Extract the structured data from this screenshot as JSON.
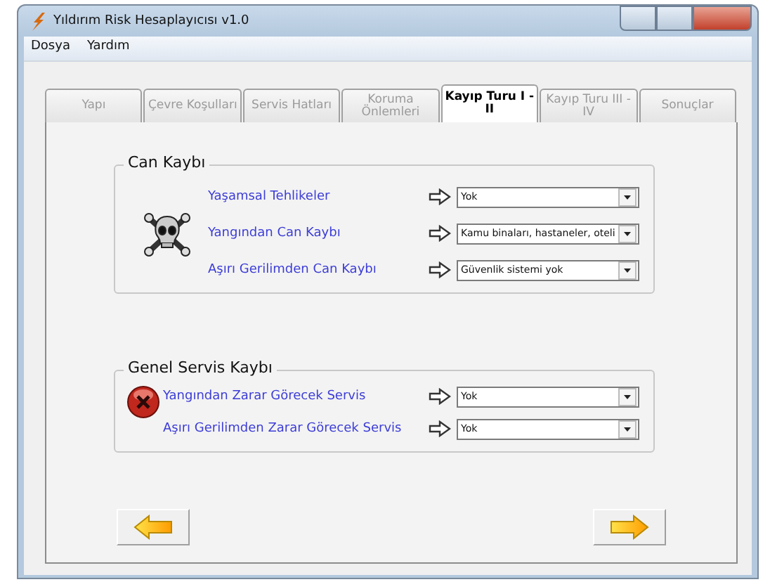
{
  "window": {
    "title": "Yıldırım Risk Hesaplayıcısı v1.0"
  },
  "menu": [
    "Dosya",
    "Yardım"
  ],
  "tabs": [
    {
      "label": "Yapı",
      "selected": false
    },
    {
      "label": "Çevre Koşulları",
      "selected": false
    },
    {
      "label": "Servis Hatları",
      "selected": false
    },
    {
      "label": "Koruma Önlemleri",
      "selected": false
    },
    {
      "label": "Kayıp Turu I - II",
      "selected": true
    },
    {
      "label": "Kayıp Turu III - IV",
      "selected": false
    },
    {
      "label": "Sonuçlar",
      "selected": false
    }
  ],
  "groups": [
    {
      "title": "Can Kaybı",
      "kind": "skull",
      "rows": [
        {
          "label": "Yaşamsal Tehlikeler",
          "value": "Yok"
        },
        {
          "label": "Yangından Can Kaybı",
          "value": "Kamu binaları, hastaneler, oteli"
        },
        {
          "label": "Aşırı Gerilimden Can Kaybı",
          "value": "Güvenlik sistemi yok"
        }
      ]
    },
    {
      "title": "Genel Servis Kaybı",
      "kind": "error",
      "rows": [
        {
          "label": "Yangından Zarar Görecek Servis",
          "value": "Yok"
        },
        {
          "label": "Aşırı Gerilimden Zarar Görecek Servis",
          "value": "Yok"
        }
      ]
    }
  ]
}
